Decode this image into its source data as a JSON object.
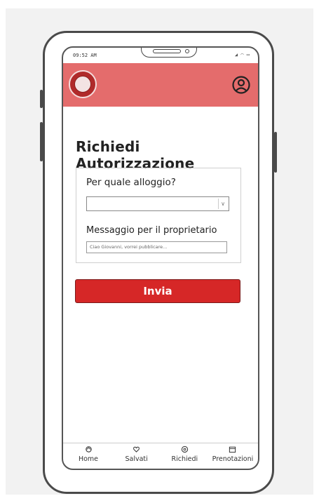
{
  "status_bar": {
    "time": "09:52 AM",
    "icons": "◢ ◠ ▭"
  },
  "header": {
    "logo": "university-seal",
    "profile_icon": "user-circle-icon",
    "accent_color": "#e46c6c"
  },
  "page": {
    "title": "Richiedi Autorizzazione"
  },
  "form": {
    "alloggio_label": "Per quale alloggio?",
    "alloggio_value": "",
    "messaggio_label": "Messaggio per il proprietario",
    "messaggio_placeholder": "Ciao Giovanni, vorrei pubblicare..."
  },
  "submit": {
    "label": "Invia",
    "color": "#d62727"
  },
  "bottom_nav": [
    {
      "label": "Home",
      "icon": "home-icon"
    },
    {
      "label": "Salvati",
      "icon": "heart-icon"
    },
    {
      "label": "Richiedi",
      "icon": "request-icon"
    },
    {
      "label": "Prenotazioni",
      "icon": "calendar-icon"
    }
  ]
}
